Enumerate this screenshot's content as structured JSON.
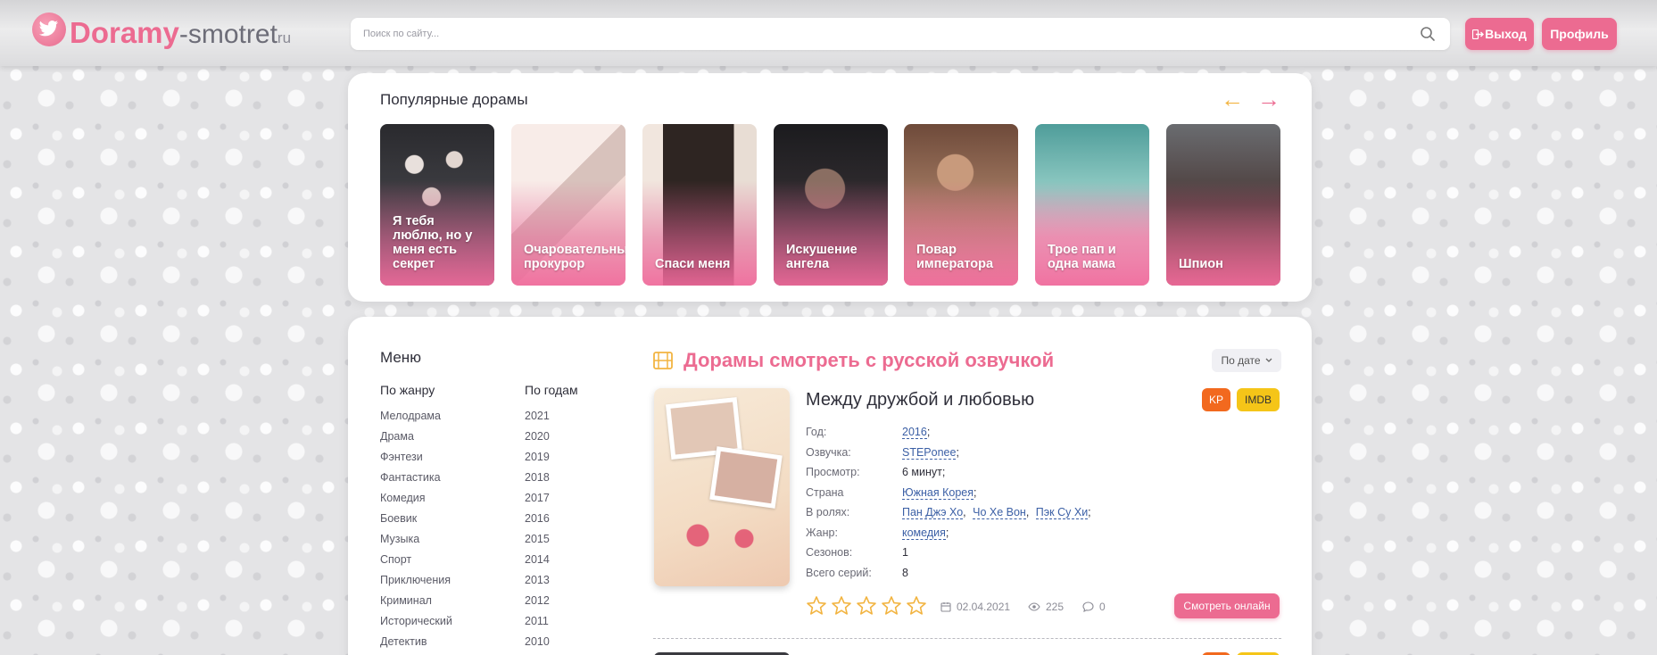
{
  "header": {
    "logo": {
      "main": "Doramy",
      "sub": "-smotret",
      "tld": "ru"
    },
    "search": {
      "placeholder": "Поиск по сайту..."
    },
    "logout_label": "Выход",
    "profile_label": "Профиль",
    "accent_color": "#ec6b91"
  },
  "popular": {
    "title": "Популярные дорамы",
    "items": [
      {
        "title": "Я тебя люблю, но у меня есть секрет"
      },
      {
        "title": "Очаровательный прокурор"
      },
      {
        "title": "Спаси меня"
      },
      {
        "title": "Искушение ангела"
      },
      {
        "title": "Повар императора"
      },
      {
        "title": "Трое пап и одна мама"
      },
      {
        "title": "Шпион"
      }
    ]
  },
  "menu": {
    "title": "Меню",
    "genres_header": "По жанру",
    "years_header": "По годам",
    "genres": [
      "Мелодрама",
      "Драма",
      "Фэнтези",
      "Фантастика",
      "Комедия",
      "Боевик",
      "Музыка",
      "Спорт",
      "Приключения",
      "Криминал",
      "Исторический",
      "Детектив"
    ],
    "years": [
      "2021",
      "2020",
      "2019",
      "2018",
      "2017",
      "2016",
      "2015",
      "2014",
      "2013",
      "2012",
      "2011",
      "2010"
    ]
  },
  "content": {
    "title": "Дорамы смотреть с русской озвучкой",
    "sort_label": "По дате",
    "item": {
      "title": "Между дружбой и любовью",
      "kp_label": "KP",
      "imdb_label": "IMDB",
      "fields": {
        "year_label": "Год:",
        "year_value": "2016",
        "voice_label": "Озвучка:",
        "voice_value": "STEPonee",
        "duration_label": "Просмотр:",
        "duration_value": "6 минут;",
        "country_label": "Страна",
        "country_value": "Южная Корея",
        "cast_label": "В ролях:",
        "cast_1": "Пан Джэ Хо",
        "cast_2": "Чо Хе Вон",
        "cast_3": "Пэк Су Хи",
        "genre_label": "Жанр:",
        "genre_value": "комедия",
        "seasons_label": "Сезонов:",
        "seasons_value": "1",
        "episodes_label": "Всего серий:",
        "episodes_value": "8"
      },
      "rating_stars": 0,
      "rating_max": 5,
      "date": "02.04.2021",
      "views": "225",
      "comments": "0",
      "watch_label": "Смотреть онлайн"
    }
  }
}
